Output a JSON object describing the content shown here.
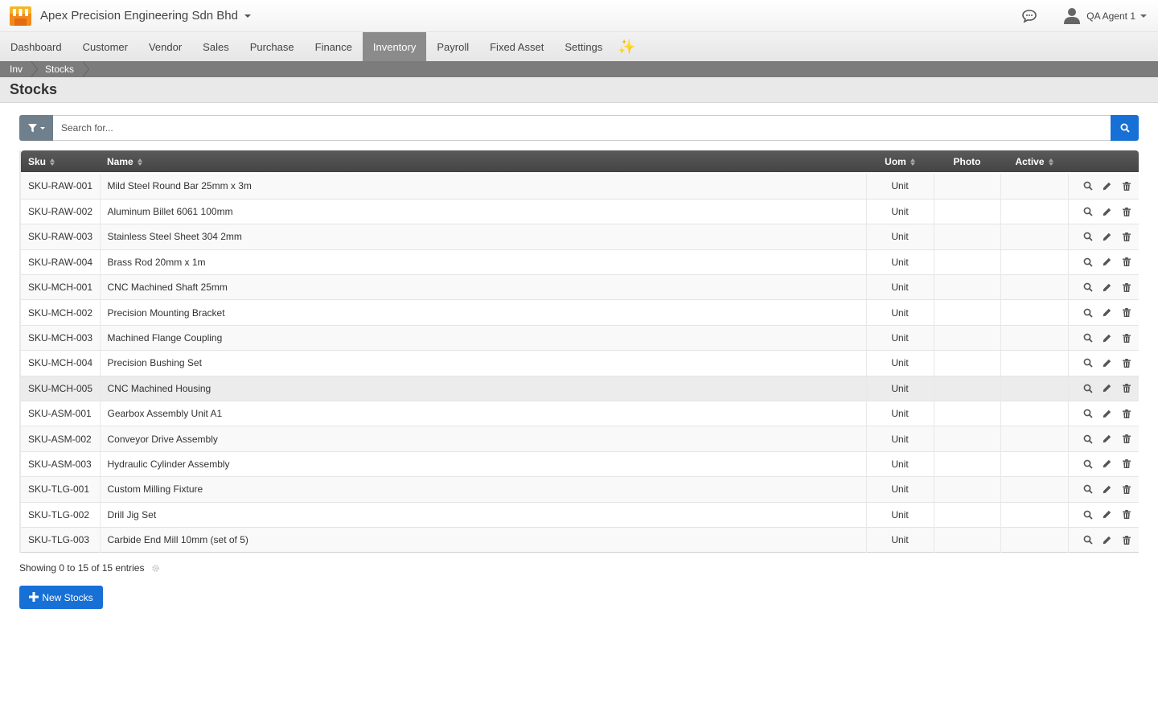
{
  "app": {
    "company_name": "Apex Precision Engineering Sdn Bhd",
    "user_name": "QA Agent 1"
  },
  "nav": {
    "items": [
      "Dashboard",
      "Customer",
      "Vendor",
      "Sales",
      "Purchase",
      "Finance",
      "Inventory",
      "Payroll",
      "Fixed Asset",
      "Settings"
    ],
    "active": "Inventory",
    "sparkle": "✨"
  },
  "breadcrumb": [
    "Inv",
    "Stocks"
  ],
  "page": {
    "title": "Stocks"
  },
  "search": {
    "placeholder": "Search for..."
  },
  "table": {
    "columns": {
      "sku": "Sku",
      "name": "Name",
      "uom": "Uom",
      "photo": "Photo",
      "active": "Active"
    },
    "rows": [
      {
        "sku": "SKU-RAW-001",
        "name": "Mild Steel Round Bar 25mm x 3m",
        "uom": "Unit"
      },
      {
        "sku": "SKU-RAW-002",
        "name": "Aluminum Billet 6061 100mm",
        "uom": "Unit"
      },
      {
        "sku": "SKU-RAW-003",
        "name": "Stainless Steel Sheet 304 2mm",
        "uom": "Unit"
      },
      {
        "sku": "SKU-RAW-004",
        "name": "Brass Rod 20mm x 1m",
        "uom": "Unit"
      },
      {
        "sku": "SKU-MCH-001",
        "name": "CNC Machined Shaft 25mm",
        "uom": "Unit"
      },
      {
        "sku": "SKU-MCH-002",
        "name": "Precision Mounting Bracket",
        "uom": "Unit"
      },
      {
        "sku": "SKU-MCH-003",
        "name": "Machined Flange Coupling",
        "uom": "Unit"
      },
      {
        "sku": "SKU-MCH-004",
        "name": "Precision Bushing Set",
        "uom": "Unit"
      },
      {
        "sku": "SKU-MCH-005",
        "name": "CNC Machined Housing",
        "uom": "Unit"
      },
      {
        "sku": "SKU-ASM-001",
        "name": "Gearbox Assembly Unit A1",
        "uom": "Unit"
      },
      {
        "sku": "SKU-ASM-002",
        "name": "Conveyor Drive Assembly",
        "uom": "Unit"
      },
      {
        "sku": "SKU-ASM-003",
        "name": "Hydraulic Cylinder Assembly",
        "uom": "Unit"
      },
      {
        "sku": "SKU-TLG-001",
        "name": "Custom Milling Fixture",
        "uom": "Unit"
      },
      {
        "sku": "SKU-TLG-002",
        "name": "Drill Jig Set",
        "uom": "Unit"
      },
      {
        "sku": "SKU-TLG-003",
        "name": "Carbide End Mill 10mm (set of 5)",
        "uom": "Unit"
      }
    ],
    "highlighted_row": 8
  },
  "footer": {
    "info": "Showing 0 to 15 of 15 entries",
    "new_button": "New Stocks"
  },
  "colors": {
    "primary": "#1670d6",
    "nav_active": "#8b8b8b",
    "breadcrumb_bg": "#7c7c7c",
    "table_header": "#4e4e4e",
    "filter_btn": "#6f7f8c"
  },
  "icons": {
    "logo": "shop-logo-icon",
    "chat": "chat-bubble-icon",
    "user": "user-icon",
    "filter": "filter-icon",
    "search": "search-icon",
    "view": "magnifier-icon",
    "edit": "pencil-icon",
    "delete": "trash-icon",
    "settings": "gear-icon",
    "add": "plus-icon"
  }
}
